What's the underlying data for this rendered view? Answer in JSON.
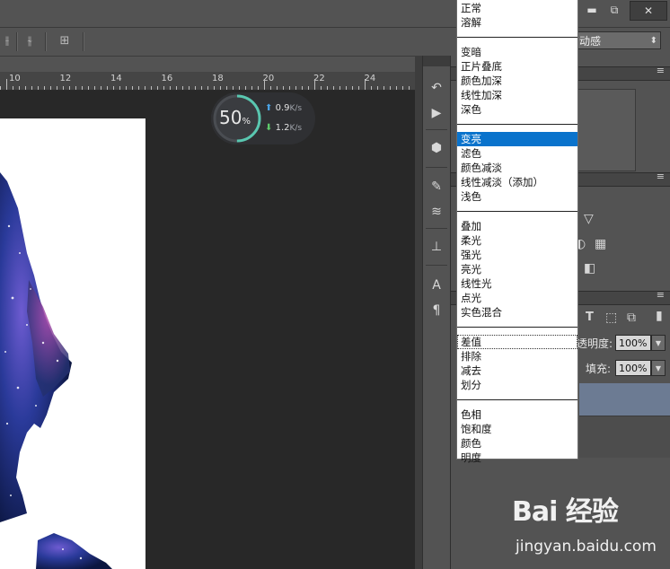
{
  "window": {
    "minimize_glyph": "▬",
    "restore_glyph": "⧉",
    "close_glyph": "✕"
  },
  "options_bar": {
    "blend_mode_value": "动感"
  },
  "ruler": {
    "labels": [
      "10",
      "12",
      "14",
      "16",
      "18",
      "20",
      "22",
      "24"
    ]
  },
  "speed_widget": {
    "percent": "50",
    "percent_unit": "%",
    "upload": "0.9",
    "download": "1.2",
    "unit": "K/s",
    "ring_fraction": 0.5
  },
  "right_panel": {
    "opacity_label": "透明度:",
    "opacity_value": "100%",
    "fill_label": "填充:",
    "fill_value": "100%",
    "type_icon_glyph": "T"
  },
  "blend_menu": {
    "groups": [
      [
        "正常",
        "溶解"
      ],
      [
        "变暗",
        "正片叠底",
        "颜色加深",
        "线性加深",
        "深色"
      ],
      [
        "变亮",
        "滤色",
        "颜色减淡",
        "线性减淡（添加）",
        "浅色"
      ],
      [
        "叠加",
        "柔光",
        "强光",
        "亮光",
        "线性光",
        "点光",
        "实色混合"
      ],
      [
        "差值",
        "排除",
        "减去",
        "划分"
      ],
      [
        "色相",
        "饱和度",
        "颜色",
        "明度"
      ]
    ],
    "selected": "变亮",
    "focused": "差值"
  },
  "watermark": {
    "logo": "Bai 经验",
    "site": "jingyan.baidu.com"
  },
  "colors": {
    "menu_highlight": "#0a73cc",
    "layer_selected": "#6c7b93",
    "speed_ring": "#59c7b0"
  }
}
